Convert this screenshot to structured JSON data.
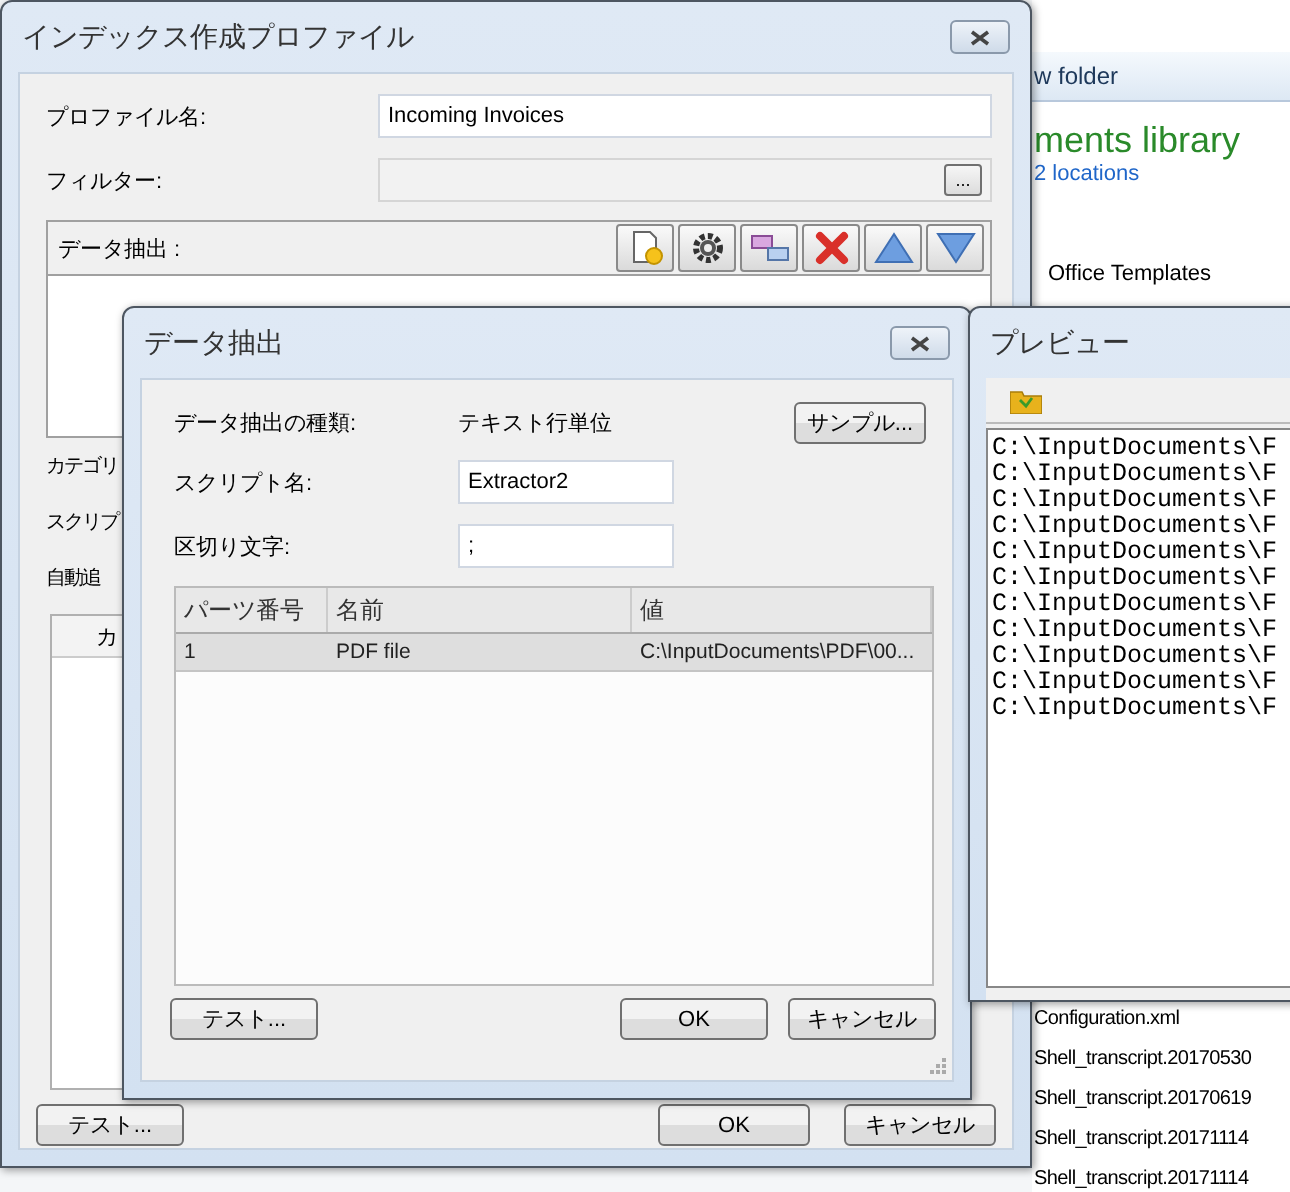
{
  "background_window": {
    "toolbar_text": "w folder",
    "library_title": "ments library",
    "locations": "2 locations",
    "folder": "Office Templates",
    "files": [
      "Configuration.xml",
      "Shell_transcript.20170530",
      "Shell_transcript.20170619",
      "Shell_transcript.20171114",
      "Shell_transcript.20171114"
    ]
  },
  "profile_window": {
    "title": "インデックス作成プロファイル",
    "fields": [
      {
        "kind": "text",
        "label": "プロファイル名:",
        "value": "Incoming Invoices",
        "disabled": false
      },
      {
        "kind": "browse",
        "label": "フィルター:",
        "disabled": true,
        "button": "..."
      }
    ],
    "extraction_label": "データ抽出 :",
    "covered_labels": [
      "カテゴリ",
      "スクリプ",
      "自動追"
    ],
    "table_column": "カ",
    "buttons": [
      "テスト...",
      "OK",
      "キャンセル"
    ]
  },
  "extraction_dialog": {
    "title": "データ抽出",
    "type_label": "データ抽出の種類:",
    "type_value": "テキスト行単位",
    "sample_button": "サンプル...",
    "fields": [
      {
        "label": "スクリプト名:",
        "value": "Extractor2"
      },
      {
        "label": "区切り文字:",
        "value": ";"
      }
    ],
    "table": {
      "columns": [
        "パーツ番号",
        "名前",
        "値"
      ],
      "rows": [
        {
          "cells": [
            "1",
            "PDF file",
            "C:\\InputDocuments\\PDF\\00..."
          ],
          "selected": true
        }
      ]
    },
    "buttons": [
      "テスト...",
      "OK",
      "キャンセル"
    ]
  },
  "preview_window": {
    "title": "プレビュー",
    "lines": [
      "C:\\InputDocuments\\F",
      "C:\\InputDocuments\\F",
      "C:\\InputDocuments\\F",
      "C:\\InputDocuments\\F",
      "C:\\InputDocuments\\F",
      "C:\\InputDocuments\\F",
      "C:\\InputDocuments\\F",
      "C:\\InputDocuments\\F",
      "C:\\InputDocuments\\F",
      "C:\\InputDocuments\\F",
      "C:\\InputDocuments\\F"
    ]
  }
}
